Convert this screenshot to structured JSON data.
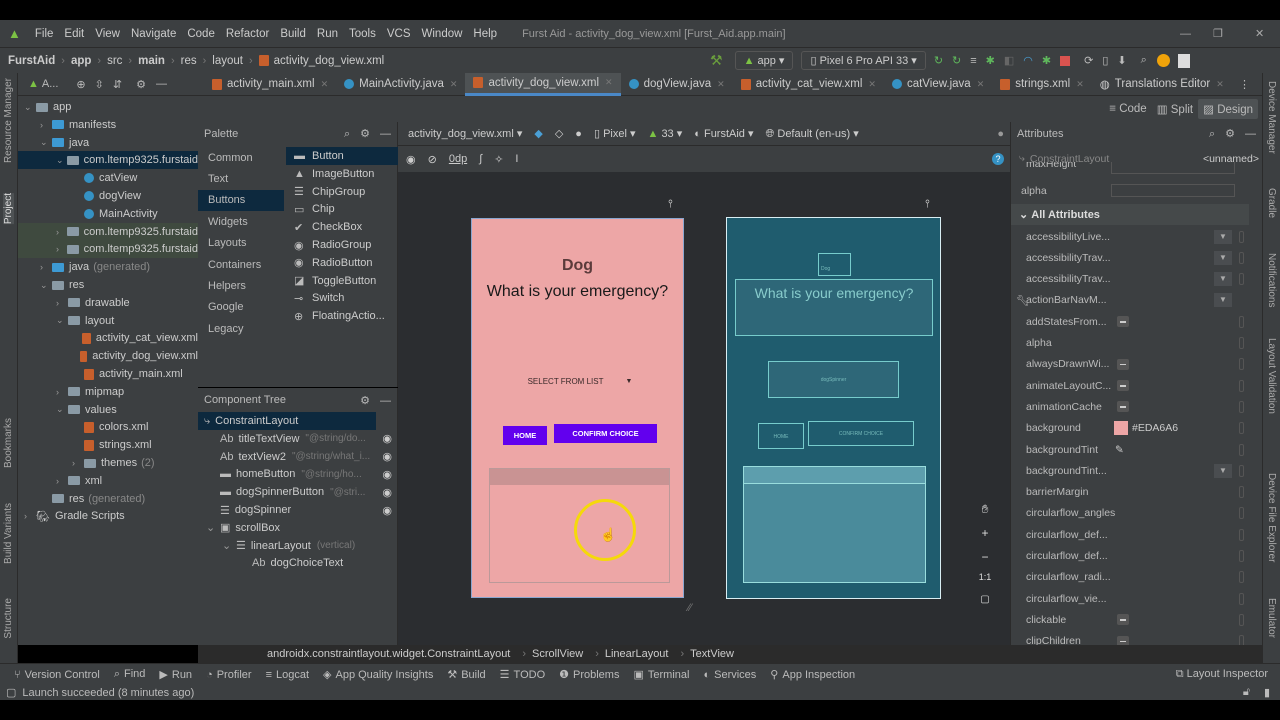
{
  "menubar": {
    "items": [
      "File",
      "Edit",
      "View",
      "Navigate",
      "Code",
      "Refactor",
      "Build",
      "Run",
      "Tools",
      "VCS",
      "Window",
      "Help"
    ],
    "title": "Furst Aid - activity_dog_view.xml [Furst_Aid.app.main]"
  },
  "navbar": {
    "crumbs": [
      "FurstAid",
      "app",
      "src",
      "main",
      "res",
      "layout",
      "activity_dog_view.xml"
    ],
    "run_config": "app",
    "device": "Pixel 6 Pro API 33"
  },
  "project": {
    "header": "A...",
    "tree": [
      {
        "label": "app",
        "depth": 0,
        "arrow": "v"
      },
      {
        "label": "manifests",
        "depth": 1,
        "arrow": ">"
      },
      {
        "label": "java",
        "depth": 1,
        "arrow": "v"
      },
      {
        "label": "com.ltemp9325.furstaid",
        "depth": 2,
        "arrow": "v"
      },
      {
        "label": "catView",
        "depth": 3,
        "arrow": ""
      },
      {
        "label": "dogView",
        "depth": 3,
        "arrow": ""
      },
      {
        "label": "MainActivity",
        "depth": 3,
        "arrow": ""
      },
      {
        "label": "com.ltemp9325.furstaid",
        "depth": 2,
        "arrow": ">"
      },
      {
        "label": "com.ltemp9325.furstaid",
        "depth": 2,
        "arrow": ">"
      },
      {
        "label": "java",
        "hint": "(generated)",
        "depth": 1,
        "arrow": ">"
      },
      {
        "label": "res",
        "depth": 1,
        "arrow": "v"
      },
      {
        "label": "drawable",
        "depth": 2,
        "arrow": ">"
      },
      {
        "label": "layout",
        "depth": 2,
        "arrow": "v"
      },
      {
        "label": "activity_cat_view.xml",
        "depth": 3,
        "arrow": ""
      },
      {
        "label": "activity_dog_view.xml",
        "depth": 3,
        "arrow": ""
      },
      {
        "label": "activity_main.xml",
        "depth": 3,
        "arrow": ""
      },
      {
        "label": "mipmap",
        "depth": 2,
        "arrow": ">"
      },
      {
        "label": "values",
        "depth": 2,
        "arrow": "v"
      },
      {
        "label": "colors.xml",
        "depth": 3,
        "arrow": ""
      },
      {
        "label": "strings.xml",
        "depth": 3,
        "arrow": ""
      },
      {
        "label": "themes",
        "hint": "(2)",
        "depth": 3,
        "arrow": ">"
      },
      {
        "label": "xml",
        "depth": 2,
        "arrow": ">"
      },
      {
        "label": "res",
        "hint": "(generated)",
        "depth": 1,
        "arrow": ""
      },
      {
        "label": "Gradle Scripts",
        "depth": 0,
        "arrow": ">"
      }
    ]
  },
  "tabs": [
    "activity_main.xml",
    "MainActivity.java",
    "activity_dog_view.xml",
    "dogView.java",
    "activity_cat_view.xml",
    "catView.java",
    "strings.xml",
    "Translations Editor"
  ],
  "modes": [
    "Code",
    "Split",
    "Design"
  ],
  "palette": {
    "title": "Palette",
    "categories": [
      "Common",
      "Text",
      "Buttons",
      "Widgets",
      "Layouts",
      "Containers",
      "Helpers",
      "Google",
      "Legacy"
    ],
    "items": [
      {
        "label": "Button",
        "icon": "▬"
      },
      {
        "label": "ImageButton",
        "icon": "▲"
      },
      {
        "label": "ChipGroup",
        "icon": "☰"
      },
      {
        "label": "Chip",
        "icon": "▭"
      },
      {
        "label": "CheckBox",
        "icon": "✔"
      },
      {
        "label": "RadioGroup",
        "icon": "◉"
      },
      {
        "label": "RadioButton",
        "icon": "◉"
      },
      {
        "label": "ToggleButton",
        "icon": "◪"
      },
      {
        "label": "Switch",
        "icon": "⊸"
      },
      {
        "label": "FloatingActio...",
        "icon": "⊕"
      }
    ]
  },
  "component_tree": {
    "title": "Component Tree",
    "items": [
      {
        "label": "ConstraintLayout",
        "icon": "⤷",
        "depth": 0,
        "hint": "",
        "eye": false
      },
      {
        "label": "titleTextView",
        "icon": "Ab",
        "depth": 1,
        "hint": "\"@string/do...",
        "eye": true
      },
      {
        "label": "textView2",
        "icon": "Ab",
        "depth": 1,
        "hint": "\"@string/what_i...",
        "eye": true
      },
      {
        "label": "homeButton",
        "icon": "▬",
        "depth": 1,
        "hint": "\"@string/ho...",
        "eye": true
      },
      {
        "label": "dogSpinnerButton",
        "icon": "▬",
        "depth": 1,
        "hint": "\"@stri...",
        "eye": true
      },
      {
        "label": "dogSpinner",
        "icon": "☰",
        "depth": 1,
        "hint": "",
        "eye": true
      },
      {
        "label": "scrollBox",
        "icon": "▣",
        "depth": 1,
        "hint": "",
        "eye": false
      },
      {
        "label": "linearLayout",
        "icon": "☰",
        "depth": 2,
        "hint": "(vertical)",
        "eye": false
      },
      {
        "label": "dogChoiceText",
        "icon": "Ab",
        "depth": 3,
        "hint": "",
        "eye": false
      }
    ]
  },
  "design_toolbar": {
    "file": "activity_dog_view.xml",
    "device": "Pixel",
    "api": "33",
    "theme": "FurstAid",
    "locale": "Default (en-us)",
    "margin": "0dp"
  },
  "preview": {
    "title": "Dog",
    "question": "What is your emergency?",
    "spinner": "SELECT FROM LIST",
    "home": "HOME",
    "confirm": "CONFIRM CHOICE",
    "bp_title": "Dog",
    "bp_spinner": "dogSpinner",
    "background": "#EDA6A6",
    "button_color": "#6200EE"
  },
  "zoom_controls": {
    "fit": "1:1"
  },
  "attributes": {
    "title": "Attributes",
    "component": "ConstraintLayout",
    "name": "<unnamed>",
    "top_rows": [
      "maxHeight",
      "alpha"
    ],
    "section": "All Attributes",
    "rows": [
      {
        "label": "accessibilityLive...",
        "ctl": "dd"
      },
      {
        "label": "accessibilityTrav...",
        "ctl": "dd"
      },
      {
        "label": "accessibilityTrav...",
        "ctl": "dd"
      },
      {
        "label": "actionBarNavM...",
        "ctl": "dd"
      },
      {
        "label": "addStatesFrom...",
        "ctl": "minus"
      },
      {
        "label": "alpha",
        "ctl": ""
      },
      {
        "label": "alwaysDrawnWi...",
        "ctl": "minus"
      },
      {
        "label": "animateLayoutC...",
        "ctl": "minus"
      },
      {
        "label": "animationCache",
        "ctl": "minus"
      },
      {
        "label": "background",
        "ctl": "color",
        "value": "#EDA6A6"
      },
      {
        "label": "backgroundTint",
        "ctl": "picker"
      },
      {
        "label": "backgroundTint...",
        "ctl": "dd"
      },
      {
        "label": "barrierMargin",
        "ctl": ""
      },
      {
        "label": "circularflow_angles",
        "ctl": ""
      },
      {
        "label": "circularflow_def...",
        "ctl": ""
      },
      {
        "label": "circularflow_def...",
        "ctl": ""
      },
      {
        "label": "circularflow_radi...",
        "ctl": ""
      },
      {
        "label": "circularflow_vie...",
        "ctl": ""
      },
      {
        "label": "clickable",
        "ctl": "minus"
      },
      {
        "label": "clipChildren",
        "ctl": "minus"
      }
    ]
  },
  "pathbar": [
    "androidx.constraintlayout.widget.ConstraintLayout",
    "ScrollView",
    "LinearLayout",
    "TextView"
  ],
  "bottom_tools": [
    {
      "icon": "⑂",
      "label": "Version Control"
    },
    {
      "icon": "⌕",
      "label": "Find"
    },
    {
      "icon": "▶",
      "label": "Run"
    },
    {
      "icon": "◔",
      "label": "Profiler"
    },
    {
      "icon": "≡",
      "label": "Logcat"
    },
    {
      "icon": "◈",
      "label": "App Quality Insights"
    },
    {
      "icon": "⚒",
      "label": "Build"
    },
    {
      "icon": "☰",
      "label": "TODO"
    },
    {
      "icon": "❶",
      "label": "Problems"
    },
    {
      "icon": "▣",
      "label": "Terminal"
    },
    {
      "icon": "◐",
      "label": "Services"
    },
    {
      "icon": "⚲",
      "label": "App Inspection"
    }
  ],
  "layout_inspector": "Layout Inspector",
  "status": "Launch succeeded (8 minutes ago)",
  "left_stripe": [
    "Resource Manager",
    "Project",
    "Bookmarks",
    "Build Variants",
    "Structure"
  ],
  "right_stripe": [
    "Device Manager",
    "Gradle",
    "Notifications",
    "Layout Validation",
    "Device File Explorer",
    "Emulator"
  ]
}
